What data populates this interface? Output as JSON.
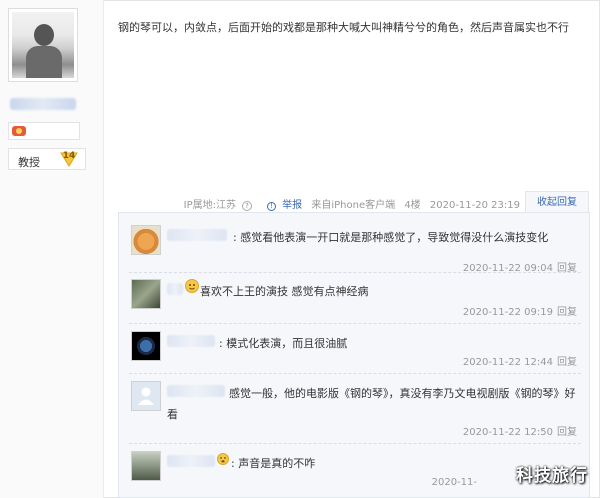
{
  "author": {
    "title_label": "教授",
    "level": "14"
  },
  "post": {
    "text": "钢的琴可以，内敛点，后面开始的戏都是那种大喊大叫神精兮兮的角色，然后声音属实也不行",
    "ip_label": "IP属地:江苏",
    "report_label": "举报",
    "source": "来自iPhone客户端",
    "floor": "4楼",
    "time": "2020-11-20 23:19",
    "collapse_label": "收起回复"
  },
  "replies": [
    {
      "text": ": 感觉看他表演一开口就是那种感觉了，导致觉得没什么演技变化",
      "time": "2020-11-22 09:04",
      "reply_label": "回复"
    },
    {
      "text": "喜欢不上王的演技 感觉有点神经病",
      "time": "2020-11-22 09:19",
      "reply_label": "回复"
    },
    {
      "text": ": 模式化表演，而且很油腻",
      "time": "2020-11-22 12:44",
      "reply_label": "回复"
    },
    {
      "text": "感觉一般，他的电影版《钢的琴》，真没有李乃文电视剧版《钢的琴》好看",
      "time": "2020-11-22 12:50",
      "reply_label": "回复"
    },
    {
      "text": ": 声音是真的不咋",
      "time": "2020-11-",
      "reply_label": "回复"
    }
  ],
  "watermark": "科技旅行",
  "colors": {
    "link": "#3a6ab0",
    "reply_bg": "#f5f7fb",
    "meta": "#999999"
  }
}
